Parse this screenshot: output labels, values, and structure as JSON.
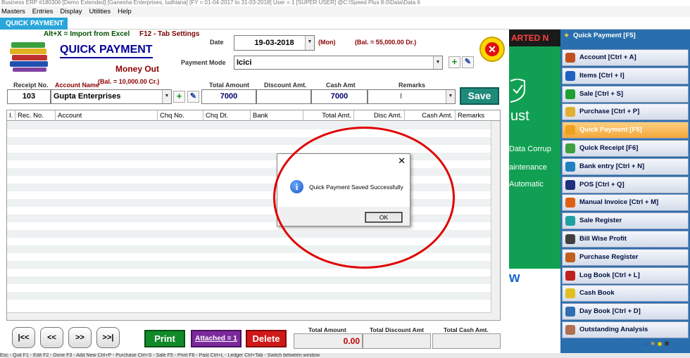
{
  "window": {
    "title": "Business ERP #180306  [Demo Extended]  [Ganesha Enterprises, ludhiana]  [FY = 01-04-2017 to 31-03-2018]  User = 1 [SUPER USER]  @C:\\Speed Plus 8.0\\Data\\Data 6"
  },
  "menu": [
    "Masters",
    "Entries",
    "Display",
    "Utilities",
    "Help"
  ],
  "tab": {
    "label": "QUICK PAYMENT"
  },
  "hints": {
    "import": "Alt+X =  Import from Excel",
    "tabs": "F12 - Tab Settings"
  },
  "form": {
    "title": "QUICK PAYMENT",
    "subtitle": "Money Out",
    "balance_left": "(Bal. =  10,000.00 Cr.)",
    "date_label": "Date",
    "date_value": "19-03-2018",
    "day": "(Mon)",
    "balance_right": "(Bal. =   55,000.00 Dr.)",
    "payment_mode_label": "Payment Mode",
    "payment_mode_value": "Icici",
    "receipt_label": "Receipt No.",
    "receipt_value": "103",
    "account_label": "Account Name",
    "account_value": "Gupta Enterprises",
    "total_amount_label": "Total Amount",
    "total_amount_value": "7000",
    "discount_label": "Discount Amt.",
    "discount_value": "",
    "cash_label": "Cash Amt",
    "cash_value": "7000",
    "remarks_label": "Remarks",
    "remarks_value": "",
    "save_label": "Save"
  },
  "grid": {
    "columns": [
      "I.",
      "Rec. No.",
      "Account",
      "Chq No.",
      "Chq Dt.",
      "Bank",
      "Total Amt.",
      "Disc Amt.",
      "Cash Amt.",
      "Remarks"
    ]
  },
  "nav": {
    "first": "|<<",
    "prev": "<<",
    "next": ">>",
    "last": ">>|"
  },
  "buttons": {
    "print": "Print",
    "attached": "Attached = 1",
    "delete": "Delete"
  },
  "footer": {
    "total_amount_label": "Total Amount",
    "total_amount_value": "0.00",
    "total_discount_label": "Total Discount Amt",
    "total_discount_value": "",
    "total_cash_label": "Total Cash Amt.",
    "total_cash_value": ""
  },
  "dialog": {
    "message": "Quick Payment Saved Successfully",
    "ok": "OK"
  },
  "promo": {
    "banner": "ARTED N",
    "line1": "ust",
    "line2": "Data Corrup",
    "line3": "aintenance",
    "line4": "Automatic",
    "line5": "w"
  },
  "sidebar": {
    "header": "Quick Payment [F5]",
    "items": [
      {
        "label": "Account [Ctrl + A]",
        "color": "#c05020"
      },
      {
        "label": "Items [Ctrl + I]",
        "color": "#2060c0"
      },
      {
        "label": "Sale [Ctrl + S]",
        "color": "#20a030"
      },
      {
        "label": "Purchase [Ctrl + P]",
        "color": "#e0b030"
      },
      {
        "label": "Quick Payment [F5]",
        "color": "#f0a020"
      },
      {
        "label": "Quick Receipt [F6]",
        "color": "#40a040"
      },
      {
        "label": "Bank entry [Ctrl + N]",
        "color": "#2080c0"
      },
      {
        "label": "POS [Ctrl + Q]",
        "color": "#203080"
      },
      {
        "label": "Manual Invoice [Ctrl + M]",
        "color": "#e06010"
      },
      {
        "label": "Sale Register",
        "color": "#20a0a0"
      },
      {
        "label": "Bill Wise Profit",
        "color": "#404040"
      },
      {
        "label": "Purchase Register",
        "color": "#c06020"
      },
      {
        "label": "Log Book [Ctrl + L]",
        "color": "#c02020"
      },
      {
        "label": "Cash Book",
        "color": "#e0c020"
      },
      {
        "label": "Day Book [Ctrl + D]",
        "color": "#3070b0"
      },
      {
        "label": "Outstanding Analysis",
        "color": "#b07050"
      }
    ]
  },
  "statusbar": "Esc - Quit    F1 - Edit    F2 - Done    F3 - Add New    Ctrl+P - Purchase    Ctrl+S - Sale    F5 - Print    F6 - Past    Ctrl+L - Ledger    Ctrl+Tab - Switch between window"
}
